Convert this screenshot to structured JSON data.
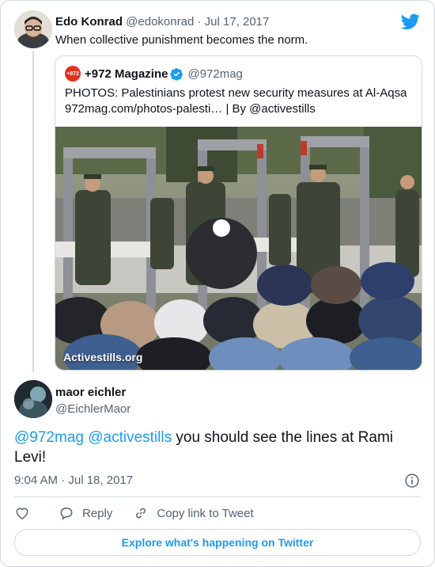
{
  "parent_tweet": {
    "author_name": "Edo Konrad",
    "author_handle": "@edokonrad",
    "separator": "·",
    "date": "Jul 17, 2017",
    "text": "When collective punishment becomes the norm."
  },
  "quoted_tweet": {
    "avatar_text": "+972",
    "author_name": "+972 Magazine",
    "author_handle": "@972mag",
    "text_line1": "PHOTOS: Palestinians protest new security measures at Al-Aqsa",
    "text_line2": "972mag.com/photos-palesti… | By @activestills",
    "photo_watermark": "Activestills.org"
  },
  "reply_tweet": {
    "author_name": "maor eichler",
    "author_handle": "@EichlerMaor",
    "mention1": "@972mag",
    "mention2": "@activestills",
    "text": " you should see the lines at Rami Levi!",
    "time": "9:04 AM · Jul 18, 2017"
  },
  "actions": {
    "reply_label": "Reply",
    "copy_label": "Copy link to Tweet"
  },
  "footer": {
    "explore_label": "Explore what's happening on Twitter"
  },
  "colors": {
    "accent": "#1d9bf0",
    "secondary_text": "#536471",
    "border": "#cfd9de",
    "brand_972": "#e0301e"
  },
  "icons": [
    "twitter-bird-icon",
    "verified-badge-icon",
    "info-icon",
    "heart-icon",
    "reply-icon",
    "link-icon"
  ]
}
